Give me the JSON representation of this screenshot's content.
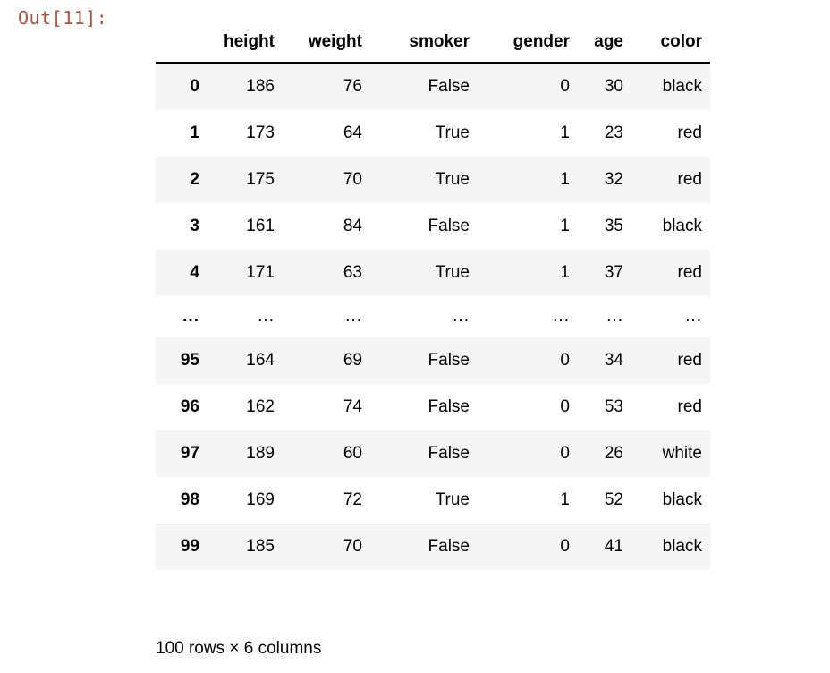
{
  "cell": {
    "prompt": "Out[11]:"
  },
  "dataframe": {
    "index_header": "",
    "columns": [
      "height",
      "weight",
      "smoker",
      "gender",
      "age",
      "color"
    ],
    "rows": [
      {
        "index": "0",
        "cells": [
          "186",
          "76",
          "False",
          "0",
          "30",
          "black"
        ]
      },
      {
        "index": "1",
        "cells": [
          "173",
          "64",
          "True",
          "1",
          "23",
          "red"
        ]
      },
      {
        "index": "2",
        "cells": [
          "175",
          "70",
          "True",
          "1",
          "32",
          "red"
        ]
      },
      {
        "index": "3",
        "cells": [
          "161",
          "84",
          "False",
          "1",
          "35",
          "black"
        ]
      },
      {
        "index": "4",
        "cells": [
          "171",
          "63",
          "True",
          "1",
          "37",
          "red"
        ]
      },
      {
        "index": "...",
        "cells": [
          "...",
          "...",
          "...",
          "...",
          "...",
          "..."
        ]
      },
      {
        "index": "95",
        "cells": [
          "164",
          "69",
          "False",
          "0",
          "34",
          "red"
        ]
      },
      {
        "index": "96",
        "cells": [
          "162",
          "74",
          "False",
          "0",
          "53",
          "red"
        ]
      },
      {
        "index": "97",
        "cells": [
          "189",
          "60",
          "False",
          "0",
          "26",
          "white"
        ]
      },
      {
        "index": "98",
        "cells": [
          "169",
          "72",
          "True",
          "1",
          "52",
          "black"
        ]
      },
      {
        "index": "99",
        "cells": [
          "185",
          "70",
          "False",
          "0",
          "41",
          "black"
        ]
      }
    ],
    "shape_caption": "100 rows × 6 columns"
  },
  "colors": {
    "prompt": "#b5503c",
    "stripe": "#f5f5f5",
    "text": "#000000",
    "rule": "#000000",
    "background": "#ffffff"
  }
}
